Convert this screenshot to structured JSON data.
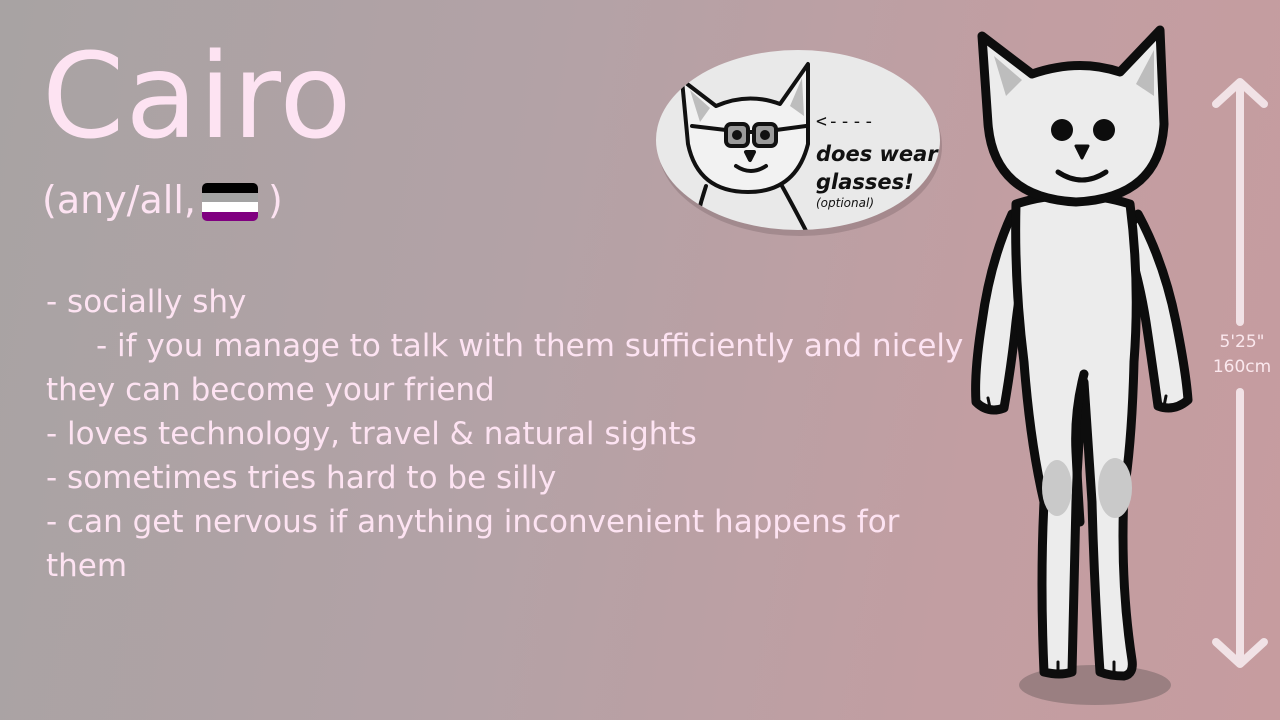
{
  "character": {
    "name": "Cairo",
    "pronouns_open": "(any/all,",
    "pronouns_close": ")",
    "flag_stripes": [
      "#000000",
      "#a3a3a3",
      "#ffffff",
      "#800080"
    ]
  },
  "traits": [
    "- socially shy",
    "- if you manage to talk with them sufficiently and nicely they can become your friend",
    "- loves technology, travel & natural sights",
    "- sometimes tries hard to be silly",
    "- can get nervous if anything inconvenient happens for them"
  ],
  "bubble": {
    "arrow": "<----",
    "text": "does wear glasses!",
    "small": "(optional)"
  },
  "height": {
    "imperial": "5'25\"",
    "metric": "160cm"
  },
  "colors": {
    "text": "#fde3f2",
    "body": "#ececec",
    "outline": "#111111"
  }
}
